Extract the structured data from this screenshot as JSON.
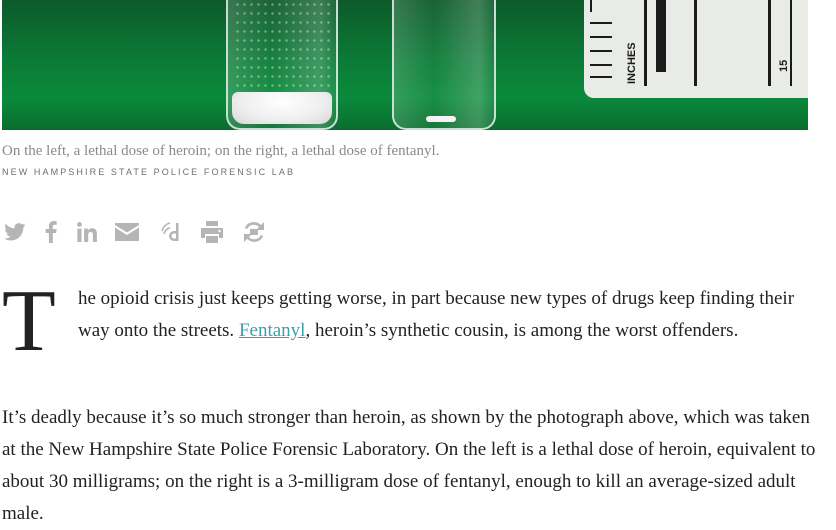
{
  "photo": {
    "alt_description_visible": false,
    "ruler_label": "INCHES",
    "ruler_number": "15"
  },
  "caption": {
    "text": "On the left, a lethal dose of heroin; on the right, a lethal dose of fentanyl.",
    "credit": "NEW HAMPSHIRE STATE POLICE FORENSIC LAB"
  },
  "share": {
    "icons": [
      "twitter-icon",
      "facebook-icon",
      "linkedin-icon",
      "email-icon",
      "digg-icon",
      "print-icon",
      "reprint-icon"
    ],
    "icon_color": "#b5b5b5"
  },
  "article": {
    "dropcap": "T",
    "lead_before_link": "he opioid crisis just keeps getting worse, in part because new types of drugs keep finding their way onto the streets. ",
    "lead_link": "Fentanyl",
    "lead_after_link": ", heroin’s synthetic cousin, is among the worst offenders.",
    "paragraph_2": "It’s deadly because it’s so much stronger than heroin, as shown by the photograph above, which was taken at the New Hampshire State Police Forensic Laboratory. On the left is a lethal dose of heroin, equivalent to about 30 milligrams; on the right is a 3-milligram dose of fentanyl, enough to kill an average-sized adult male.",
    "link_color": "#3b9fae"
  }
}
